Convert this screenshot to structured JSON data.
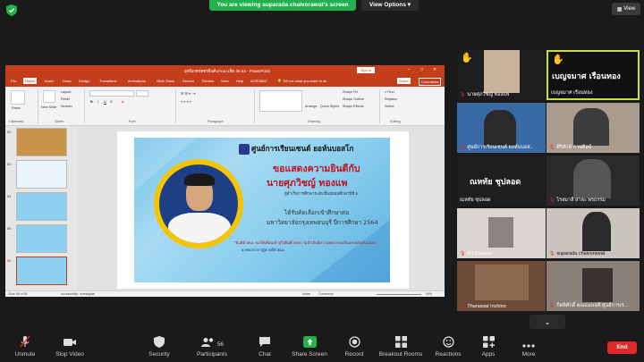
{
  "zoom": {
    "share_banner": "You are viewing suparada chaivorawat's screen",
    "view_options": "View Options",
    "view_button": "View",
    "end_button": "End",
    "participants_count": "56",
    "toolbar": [
      {
        "id": "unmute",
        "label": "Unmute"
      },
      {
        "id": "stop-video",
        "label": "Stop Video"
      },
      {
        "id": "security",
        "label": "Security"
      },
      {
        "id": "participants",
        "label": "Participants"
      },
      {
        "id": "chat",
        "label": "Chat"
      },
      {
        "id": "share-screen",
        "label": "Share Screen"
      },
      {
        "id": "record",
        "label": "Record"
      },
      {
        "id": "breakout-rooms",
        "label": "Breakout Rooms"
      },
      {
        "id": "reactions",
        "label": "Reactions"
      },
      {
        "id": "apps",
        "label": "Apps"
      },
      {
        "id": "more",
        "label": "More"
      }
    ],
    "participants": [
      {
        "name": "นายศุภวิชญ์ ทองแพ",
        "big": ""
      },
      {
        "name": "เบญจมาศ เรือนทอง",
        "big": "เบญจมาศ เรือนทอง"
      },
      {
        "name": "ศูนย์การเรียนเซนต์ ยอห์นบอส..",
        "big": ""
      },
      {
        "name": "ศิริลักษ์ กาฬศิลป์",
        "big": ""
      },
      {
        "name": "ณหทัย ชุปลอด",
        "big": "ณหทัย ชุปลอด"
      },
      {
        "name": "ไรสมาลี สาละ พรธรรม",
        "big": ""
      },
      {
        "name": "iP13yokyee",
        "big": ""
      },
      {
        "name": "suparada chaivorawat",
        "big": ""
      },
      {
        "name": "Thanawat Inchino",
        "big": ""
      },
      {
        "name": "กิตติศักดิ์ คุณแมนจุฬ์ ศูนย์การเร...",
        "big": ""
      }
    ]
  },
  "powerpoint": {
    "title": "ยุชนิเกตรคตรยินดีแกะมะเห็ด 35.64 - PowerPoint",
    "signin": "Sign in",
    "tabs": [
      "File",
      "Home",
      "Insert",
      "Draw",
      "Design",
      "Transitions",
      "Animations",
      "Slide Show",
      "Record",
      "Review",
      "View",
      "Help",
      "ACROBAT"
    ],
    "tell_me": "Tell me what you want to do",
    "ribbon_groups": [
      "Clipboard",
      "Slides",
      "Font",
      "Paragraph",
      "Drawing",
      "Editing"
    ],
    "ribbon_items": {
      "paste": "Paste",
      "new_slide": "New Slide",
      "layout": "Layout",
      "reset": "Reset",
      "section": "Section",
      "arrange": "Arrange",
      "quick_styles": "Quick Styles",
      "shape_fill": "Shape Fill",
      "shape_outline": "Shape Outline",
      "shape_effects": "Shape Effects",
      "find": "Find",
      "replace": "Replace",
      "select": "Select",
      "share": "Share",
      "comments": "Comments"
    },
    "thumbs": [
      "52",
      "53",
      "54",
      "55",
      "56"
    ],
    "status_left": "Slide 56 of 58",
    "status_accessibility": "Accessibility: Investigate",
    "status_notes": "Notes",
    "status_comments": "Comments",
    "zoom_pct": "49%"
  },
  "slide": {
    "school": "ศูนย์การเรียนเซนต์ ยอห์นบอสโก",
    "congrats": "ขอแสดงความยินดีกับ",
    "name": "นายศุภวิชญ์ ทองแพ",
    "sub1": "ผู้สำเร็จการศึกษาระดับชั้นมัธยมศึกษาปีที่ 6",
    "sub2": "ได้รับคัดเลือกเข้าศึกษาต่อ",
    "sub3": "มหาวิทยาลัยกรุงเทพธนบุรี ปีการศึกษา 2564",
    "quote1": "\"ยินดีด้วยนะ ขอให้เพื่อนเข้าสู่ใฝ่ฝันที่ ทุกความสำเร็จมีความพยายามเป็นแรงผลักดันเสมอ\"",
    "quote2": "ยุวชนจากปาฏิหารย์ด้วยนะ"
  },
  "colors": {
    "ppt_accent": "#c43e1c",
    "share_green": "#23b14d",
    "end_red": "#e02828",
    "slide_red": "#c1121f",
    "ring_yellow": "#f4c400"
  }
}
